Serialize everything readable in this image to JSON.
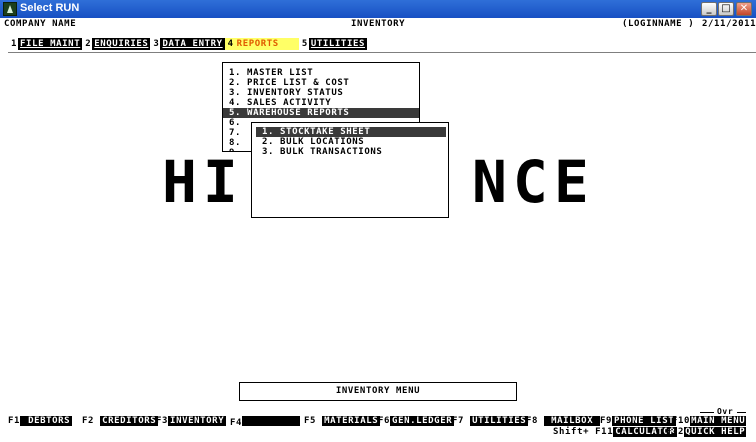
{
  "window": {
    "title": "Select RUN",
    "icon": "app-icon",
    "controls": [
      "minimize",
      "maximize",
      "close"
    ]
  },
  "header": {
    "company": "COMPANY NAME",
    "module": "INVENTORY",
    "login": "(LOGINNAME )",
    "date": "2/11/2011"
  },
  "menubar": [
    {
      "num": "1",
      "label": "FILE MAINT"
    },
    {
      "num": "2",
      "label": "ENQUIRIES"
    },
    {
      "num": "3",
      "label": "DATA ENTRY"
    },
    {
      "num": "4",
      "label": "REPORTS",
      "active": true
    },
    {
      "num": "5",
      "label": "UTILITIES"
    }
  ],
  "watermark": {
    "left": "HI",
    "right": "NCE"
  },
  "reports_menu": {
    "items": [
      "1. MASTER LIST",
      "2. PRICE LIST & COST",
      "3. INVENTORY STATUS",
      "4. SALES ACTIVITY",
      "5. WAREHOUSE REPORTS",
      "6.",
      "7.",
      "8.",
      "9."
    ],
    "selected": 4
  },
  "warehouse_submenu": {
    "items": [
      "1. STOCKTAKE SHEET",
      "2. BULK LOCATIONS",
      "3. BULK TRANSACTIONS"
    ],
    "selected": 0
  },
  "status_box": "INVENTORY MENU",
  "overwrite": "Ovr",
  "function_keys": [
    {
      "key": "F1",
      "label": " DEBTORS"
    },
    {
      "key": "F2",
      "label": "CREDITORS"
    },
    {
      "key": "F3",
      "label": "INVENTORY"
    },
    {
      "key": "F4",
      "label": ""
    },
    {
      "key": "F5",
      "label": "MATERIALS"
    },
    {
      "key": "F6",
      "label": "GEN.LEDGER"
    },
    {
      "key": "F7",
      "label": "UTILITIES"
    },
    {
      "key": "F8",
      "label": "MAILBOX"
    },
    {
      "key": "F9",
      "label": "PHONE LIST"
    },
    {
      "key": "F10",
      "label": "MAIN MENU"
    }
  ],
  "shift_keys": {
    "prefix": "Shift+",
    "f11_key": "F11",
    "f11_label": "CALCULATOR",
    "f12_key": "F12",
    "f12_label": "QUICK HELP"
  }
}
